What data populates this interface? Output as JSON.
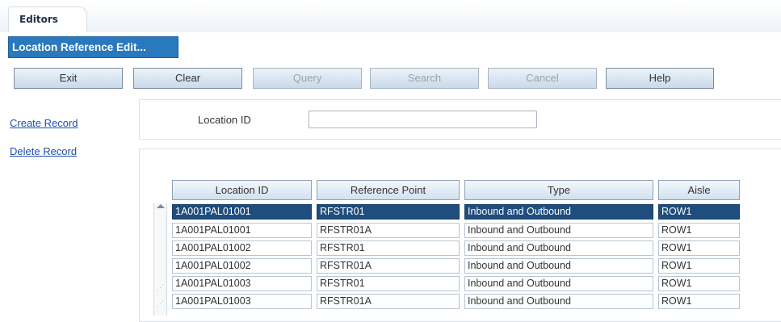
{
  "tab": {
    "label": "Editors"
  },
  "window": {
    "title": "Location Reference Edit..."
  },
  "toolbar": {
    "buttons": [
      {
        "label": "Exit",
        "enabled": true
      },
      {
        "label": "Clear",
        "enabled": true
      },
      {
        "label": "Query",
        "enabled": false
      },
      {
        "label": "Search",
        "enabled": false
      },
      {
        "label": "Cancel",
        "enabled": false
      },
      {
        "label": "Help",
        "enabled": true
      }
    ]
  },
  "sidebar": {
    "links": [
      {
        "label": "Create Record"
      },
      {
        "label": "Delete Record"
      }
    ]
  },
  "filter": {
    "label": "Location ID",
    "value": ""
  },
  "table": {
    "columns": [
      "Location ID",
      "Reference Point",
      "Type",
      "Aisle"
    ],
    "rows": [
      [
        "1A001PAL01001",
        "RFSTR01",
        "Inbound and Outbound",
        "ROW1"
      ],
      [
        "1A001PAL01001",
        "RFSTR01A",
        "Inbound and Outbound",
        "ROW1"
      ],
      [
        "1A001PAL01002",
        "RFSTR01",
        "Inbound and Outbound",
        "ROW1"
      ],
      [
        "1A001PAL01002",
        "RFSTR01A",
        "Inbound and Outbound",
        "ROW1"
      ],
      [
        "1A001PAL01003",
        "RFSTR01",
        "Inbound and Outbound",
        "ROW1"
      ],
      [
        "1A001PAL01003",
        "RFSTR01A",
        "Inbound and Outbound",
        "ROW1"
      ]
    ],
    "selected_row": 0
  },
  "colors": {
    "title_bar": "#2a78bd",
    "selected_row": "#1f4d7d",
    "link": "#1f4fa8"
  },
  "icons": {
    "scroll_up": "triangle-up-icon"
  }
}
